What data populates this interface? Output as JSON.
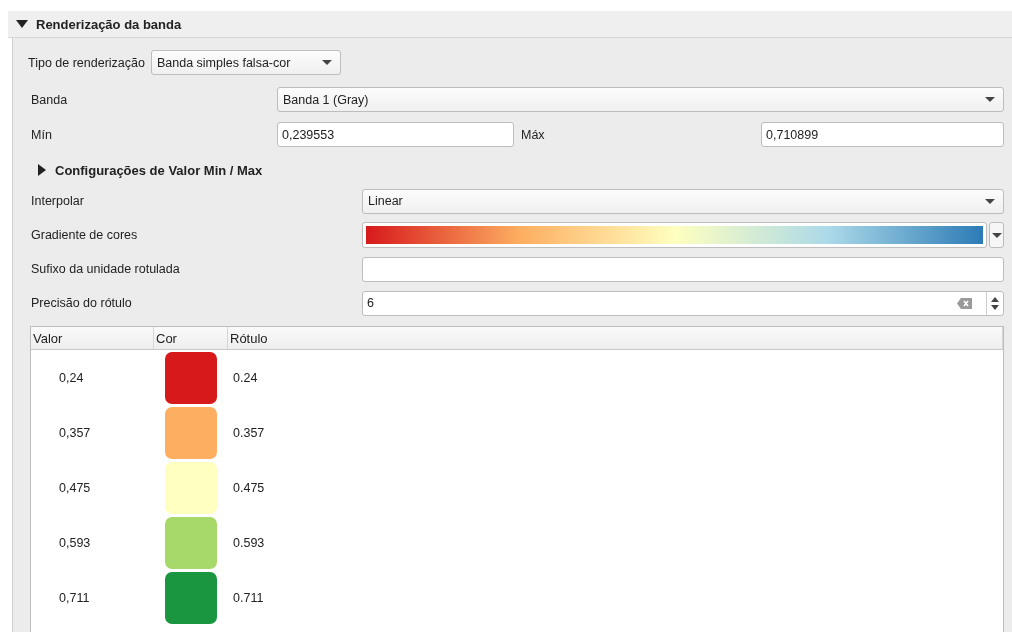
{
  "section": {
    "title": "Renderização da banda",
    "expanded": true
  },
  "render_type": {
    "label": "Tipo de renderização",
    "value": "Banda simples falsa-cor"
  },
  "band": {
    "label": "Banda",
    "value": "Banda 1 (Gray)"
  },
  "min": {
    "label": "Mín",
    "value": "0,239553"
  },
  "max": {
    "label": "Máx",
    "value": "0,710899"
  },
  "minmax_settings": {
    "title": "Configurações de Valor Min / Max",
    "expanded": false
  },
  "interpolate": {
    "label": "Interpolar",
    "value": "Linear"
  },
  "color_ramp": {
    "label": "Gradiente de cores"
  },
  "unit_suffix": {
    "label": "Sufixo da unidade rotulada"
  },
  "label_precision": {
    "label": "Precisão do rótulo",
    "value": "6"
  },
  "table": {
    "columns": [
      "Valor",
      "Cor",
      "Rótulo"
    ],
    "rows": [
      {
        "value": "0,24",
        "color": "#d7191c",
        "label": "0.24"
      },
      {
        "value": "0,357",
        "color": "#fdae61",
        "label": "0.357"
      },
      {
        "value": "0,475",
        "color": "#ffffbf",
        "label": "0.475"
      },
      {
        "value": "0,593",
        "color": "#a6d96a",
        "label": "0.593"
      },
      {
        "value": "0,711",
        "color": "#1a9641",
        "label": "0.711"
      }
    ]
  }
}
